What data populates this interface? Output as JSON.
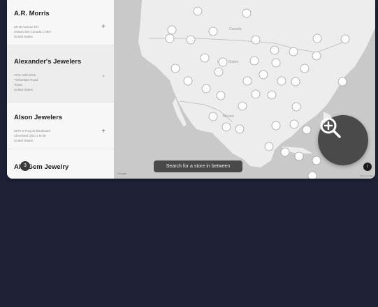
{
  "stores": [
    {
      "name": "A.R. Morris",
      "lines": [
        "28-48 Avenue Rd",
        "Ontario M4 Canada 1 M5Y",
        "United States"
      ],
      "toggle": "+"
    },
    {
      "name": "Alexander's Jewelers",
      "lines": [
        "4701 Mall Drive",
        "Timberlake Road",
        "Texas",
        "United States"
      ],
      "toggle": "-"
    },
    {
      "name": "Alson Jewelers",
      "lines": [
        "5975 S Prog St Boulevard",
        "Cleveland Ohio 1 M 68",
        "United States"
      ],
      "toggle": "+"
    },
    {
      "name": "Al's Gem Jewelry",
      "lines": [],
      "toggle": ""
    }
  ],
  "list_badge": "3",
  "map": {
    "background": "#c9c9c9",
    "land": "#ededed",
    "water": "#c9c9c9",
    "labels": {
      "country1": "Canada",
      "country2": "United States",
      "country3": "Mexico"
    },
    "search_hint": "Search for a store in between",
    "zoom_icon": "zoom-in-icon",
    "info_label": "i",
    "google_label": "Google",
    "terms_label": "Terms of Use"
  }
}
